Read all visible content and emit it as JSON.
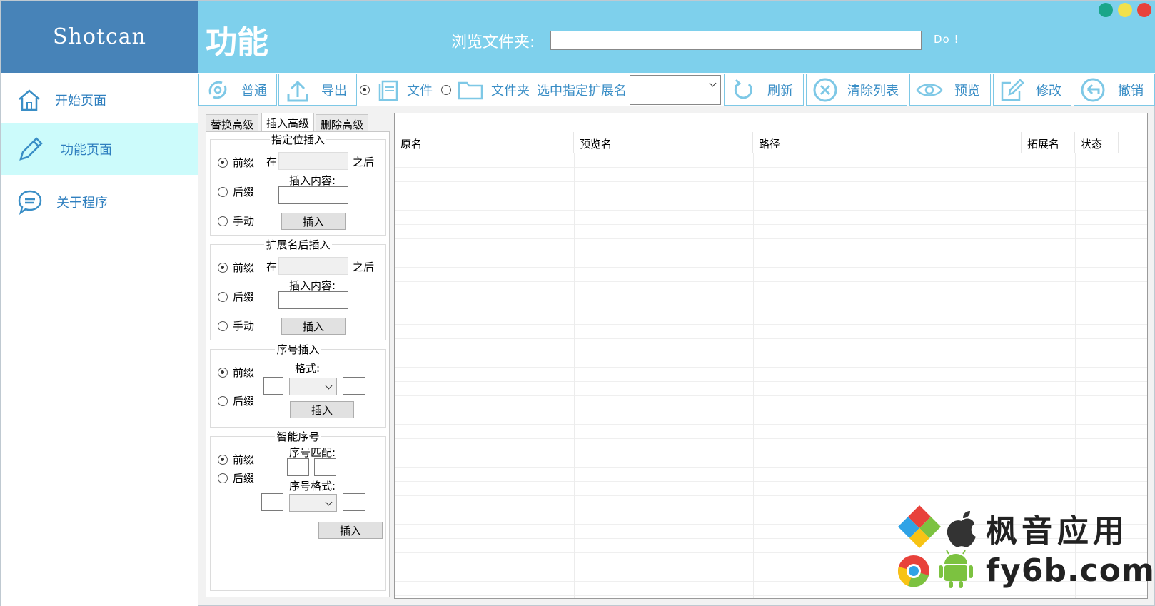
{
  "app": {
    "title": "Shotcan"
  },
  "sidebar": {
    "items": [
      {
        "label": "开始页面",
        "icon": "home-icon"
      },
      {
        "label": "功能页面",
        "icon": "pencil-icon",
        "active": true
      },
      {
        "label": "关于程序",
        "icon": "chat-bubble-icon"
      }
    ]
  },
  "header": {
    "title": "功能",
    "browse_label": "浏览文件夹:",
    "browse_value": "",
    "do_label": "Do !"
  },
  "window_controls": {
    "colors": [
      "#1aa68a",
      "#f2e14b",
      "#e8423b"
    ]
  },
  "toolbar": {
    "normal": "普通",
    "export": "导出",
    "file_radio": "文件",
    "folder_radio": "文件夹",
    "select_ext_label": "选中指定扩展名",
    "ext_value": "",
    "refresh": "刷新",
    "clear_list": "清除列表",
    "preview": "预览",
    "modify": "修改",
    "undo": "撤销"
  },
  "tabs": [
    "替换高级",
    "插入高级",
    "删除高级"
  ],
  "active_tab": "插入高级",
  "groups": {
    "pos_insert": {
      "title": "指定位插入",
      "prefix": "前缀",
      "suffix": "后缀",
      "manual": "手动",
      "at": "在",
      "after": "之后",
      "content_label": "插入内容:",
      "insert": "插入"
    },
    "ext_insert": {
      "title": "扩展名后插入",
      "prefix": "前缀",
      "suffix": "后缀",
      "manual": "手动",
      "at": "在",
      "after": "之后",
      "content_label": "插入内容:",
      "insert": "插入"
    },
    "seq_insert": {
      "title": "序号插入",
      "prefix": "前缀",
      "suffix": "后缀",
      "format_label": "格式:",
      "insert": "插入"
    },
    "smart_seq": {
      "title": "智能序号",
      "prefix": "前缀",
      "suffix": "后缀",
      "match_label": "序号匹配:",
      "format_label": "序号格式:",
      "insert": "插入"
    }
  },
  "table": {
    "columns": [
      "原名",
      "预览名",
      "路径",
      "拓展名",
      "状态"
    ],
    "rows": []
  },
  "watermark": {
    "title": "枫音应用",
    "url": "fy6b.com"
  },
  "colors": {
    "accent": "#7ed0ec",
    "brand": "#4783b8",
    "active_nav": "#ccfbfb",
    "icon_blue": "#3a8ec6"
  }
}
